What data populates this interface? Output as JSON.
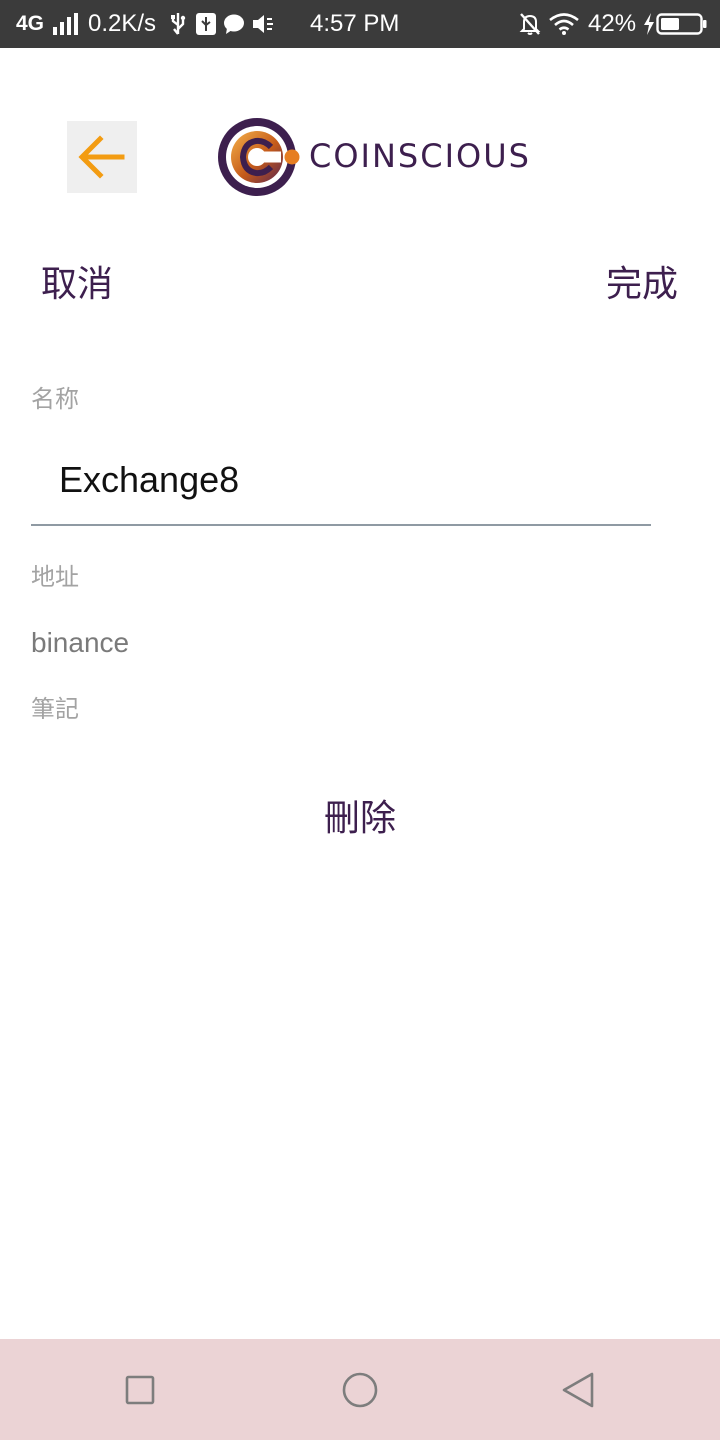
{
  "status_bar": {
    "network": "4G",
    "speed": "0.2K/s",
    "time": "4:57 PM",
    "battery_percent": "42%",
    "icons": [
      "signal-icon",
      "usb-icon",
      "usb-debug-icon",
      "chat-icon",
      "mute-icon",
      "silent-icon",
      "wifi-icon",
      "charging-icon",
      "battery-icon"
    ]
  },
  "header": {
    "back_icon": "arrow-left-icon",
    "brand_name": "COINSCIOUS",
    "colors": {
      "back_arrow": "#f39c12",
      "brand": "#3d1f4e",
      "logo_orange": "#e67e22"
    }
  },
  "actions": {
    "cancel_label": "取消",
    "done_label": "完成"
  },
  "form": {
    "name_label": "名称",
    "name_value": "Exchange8",
    "address_label": "地址",
    "address_value": "binance",
    "note_label": "筆記"
  },
  "delete_label": "刪除",
  "nav_bar": {
    "icons": [
      "recent-apps-icon",
      "home-icon",
      "back-triangle-icon"
    ],
    "background": "#ebd3d5"
  }
}
